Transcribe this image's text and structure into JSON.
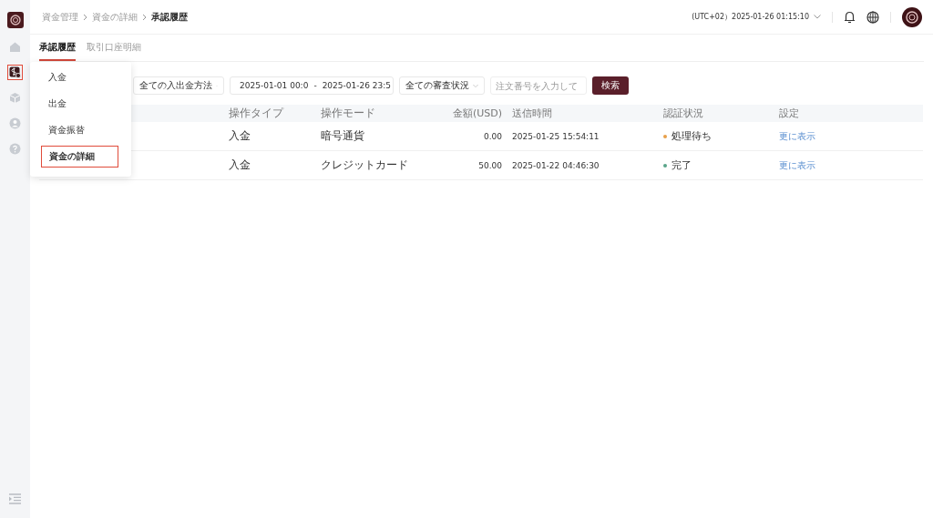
{
  "sidebar": {
    "items": [
      {
        "kind": "home",
        "selected": false
      },
      {
        "kind": "funds",
        "selected": true
      },
      {
        "kind": "cube",
        "selected": false
      },
      {
        "kind": "user",
        "selected": false
      },
      {
        "kind": "help",
        "selected": false
      }
    ]
  },
  "breadcrumb": [
    "資金管理",
    "資金の詳細",
    "承認履歴"
  ],
  "header": {
    "timezone": "(UTC+02）2025-01-26 01:15:10"
  },
  "tabs": [
    {
      "label": "承認履歴",
      "selected": true
    },
    {
      "label": "取引口座明細",
      "selected": false
    }
  ],
  "filters": {
    "method": "全ての入出金方法",
    "date_start": "2025-01-01 00:0",
    "date_sep": "-",
    "date_end": "2025-01-26 23:5",
    "status": "全ての審査状況",
    "order_placeholder": "注文番号を入力して",
    "search_button": "検索"
  },
  "table": {
    "columns": [
      "操作タイプ",
      "操作モード",
      "金額(USD)",
      "送信時間",
      "認証状況",
      "設定"
    ],
    "rows": [
      {
        "type": "入金",
        "mode": "暗号通貨",
        "amount": "0.00",
        "time": "2025-01-25 15:54:11",
        "status": "処理待ち",
        "color": "#e8a04a",
        "action": "更に表示"
      },
      {
        "type": "入金",
        "mode": "クレジットカード",
        "amount": "50.00",
        "time": "2025-01-22 04:46:30",
        "status": "完了",
        "color": "#5aa58a",
        "action": "更に表示"
      }
    ]
  },
  "menu": {
    "items": [
      {
        "label": "入金",
        "selected": false
      },
      {
        "label": "出金",
        "selected": false
      },
      {
        "label": "資金振替",
        "selected": false
      },
      {
        "label": "資金の詳細",
        "selected": true
      }
    ]
  }
}
